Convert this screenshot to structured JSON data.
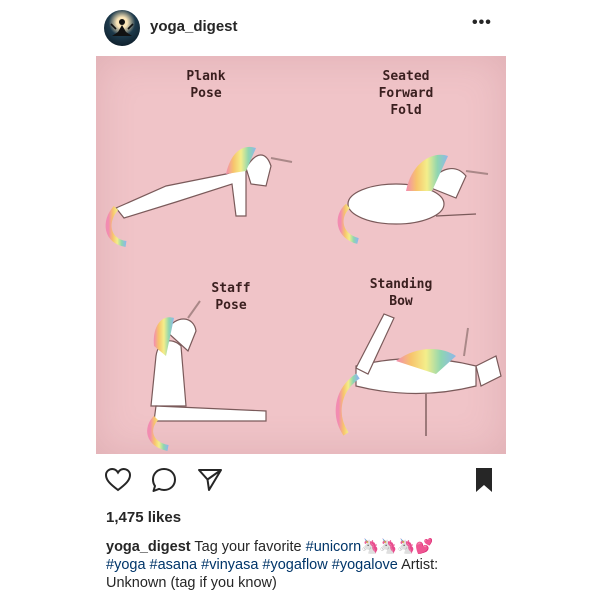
{
  "post": {
    "username": "yoga_digest",
    "more_label": "•••",
    "likes": "1,475 likes",
    "caption": {
      "username": "yoga_digest",
      "text_before": "Tag your favorite",
      "unicorn_tag": "#unicorn",
      "emojis": "🦄🦄🦄💕",
      "hashtags": [
        "#yoga",
        "#asana",
        "#vinyasa",
        "#yogaflow",
        "#yogalove"
      ],
      "artist_text": "Artist: Unknown (tag if you know)"
    }
  },
  "image": {
    "background_color": "#f0c4c8",
    "poses": [
      {
        "label": "Plank\nPose"
      },
      {
        "label": "Seated\nForward\nFold"
      },
      {
        "label": "Staff\nPose"
      },
      {
        "label": "Standing\nBow"
      }
    ]
  },
  "icons": {
    "like": "heart-icon",
    "comment": "comment-icon",
    "share": "share-icon",
    "save": "bookmark-icon"
  }
}
